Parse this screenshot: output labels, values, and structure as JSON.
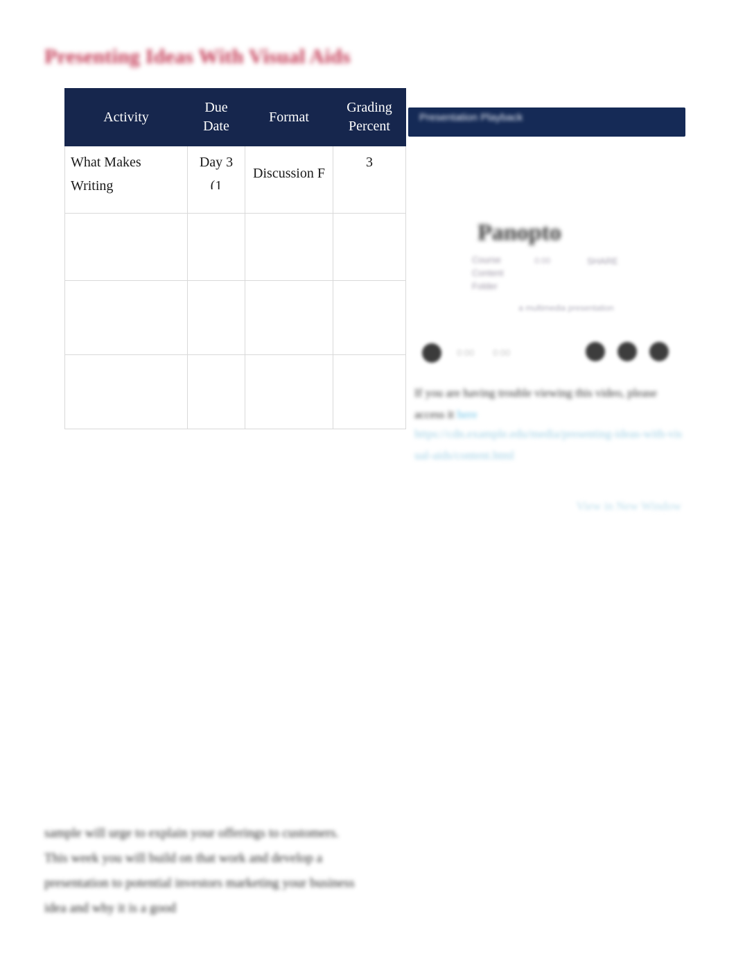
{
  "page": {
    "title": "Presenting Ideas With Visual Aids",
    "title_color": "#c43b56"
  },
  "schedule_table": {
    "header_bg": "#16264d",
    "columns": [
      "Activity",
      "Due Date",
      "Format",
      "Grading Percent"
    ],
    "rows": [
      {
        "activity": "What Makes Writing",
        "due_date": "Day 3 (1",
        "format": "Discussion F",
        "grading_percent": "3"
      },
      {
        "activity": "",
        "due_date": "",
        "format": "",
        "grading_percent": ""
      },
      {
        "activity": "",
        "due_date": "",
        "format": "",
        "grading_percent": ""
      },
      {
        "activity": "",
        "due_date": "",
        "format": "",
        "grading_percent": ""
      }
    ]
  },
  "video_panel": {
    "header_bg": "#152a56",
    "header_title": "Presentation Playback",
    "brand": {
      "logo_text": "Panopto",
      "sub_left": "Course Content Folder",
      "sub_mid": "0:00",
      "sub_right": "SHARE",
      "caption": "a multimedia presentation"
    },
    "player": {
      "play_label": "Play",
      "time_current": "0:00",
      "time_total": "0:00",
      "controls": [
        "volume-icon",
        "settings-icon",
        "fullscreen-icon"
      ]
    },
    "fallback": {
      "note_line1": "If you are having trouble viewing this",
      "note_line2": "video, please access it",
      "note_link": "here",
      "url": "https://cdn.example.edu/media/presenting-ideas-with-visual-aids/content.html",
      "new_window_link": "View in New Window"
    }
  },
  "body": {
    "paragraph": "sample will urge to explain your offerings to customers. This week you will build on that work and develop a presentation to potential investors marketing your business idea and why it is a good"
  },
  "icons": {
    "play": "play-icon",
    "volume": "volume-icon",
    "settings": "settings-icon",
    "fullscreen": "fullscreen-icon"
  }
}
